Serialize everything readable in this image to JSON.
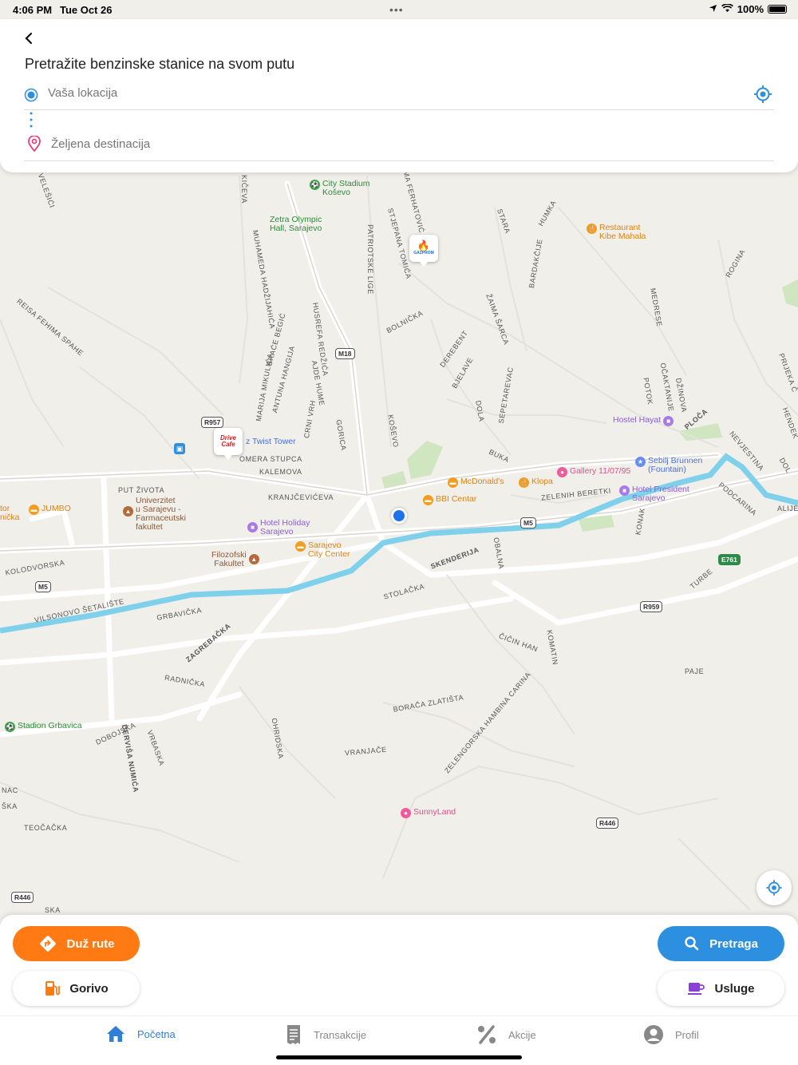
{
  "status_bar": {
    "time": "4:06 PM",
    "date": "Tue Oct 26",
    "dots": "•••",
    "battery": "100%"
  },
  "search": {
    "title": "Pretražite benzinske stanice na svom putu",
    "origin_placeholder": "Vaša lokacija",
    "destination_placeholder": "Željena destinacija"
  },
  "map": {
    "streets": [
      "J VELEŠIĆI",
      "KIČEVA",
      "ASIMA FERHATOVIĆ",
      "STARA",
      "HUMKA",
      "REISA FEHIMA SPAHE",
      "MUHAMEDA HADŽIJAHIĆA",
      "PATRIOTSKE LIGE",
      "STJEPANA TOMIĆA",
      "BARDAKČIJE",
      "ROGINA",
      "BOLNIČKA",
      "HUSREFA REDŽIĆA",
      "BRAĆE BEGIĆ",
      "ŽAIMA ŠARCA",
      "MEDRESE",
      "DEREBENT",
      "MARIJA MIKULIĆA",
      "ANTUNA HANGIJA",
      "AJDE HUME",
      "BJELAVE",
      "OČAKTANIJE",
      "PRIJEKA Č",
      "POTOK",
      "DŽINOVA",
      "CRNI VRH",
      "KOŠEVO",
      "DOLA",
      "SEPETAREVAC",
      "PLOČA",
      "HENDEK",
      "NEVJESTINA",
      "GORICA",
      "OMERA STUPCA",
      "BUKA",
      "KALEMOVA",
      "PUT ŽIVOTA",
      "KRANJČEVIĆEVA",
      "ZELENIH BERETKI",
      "PODCARINA",
      "ALIJE",
      "KONAK",
      "KOLODVORSKA",
      "SKENDERIJA",
      "OBALNA",
      "TURBE",
      "VILSONOVO ŠETALIŠTE",
      "STOLAČKA",
      "GRBAVIČKA",
      "ZAGREBAČKA",
      "ČIČIN HAN",
      "KOMATIN",
      "PAJE",
      "RADNIČKA",
      "BORAČA ZLATIŠTA",
      "DOBOJSKA",
      "DERVIŠA NUMIĆA",
      "OHRIDSKA",
      "VRBASKA",
      "VRANJAČE",
      "ZELENGORSKA HAMBINA CARINA",
      "TEOČAČKA",
      "NAC",
      "SKA",
      "ŠKA",
      "DOL"
    ],
    "pois": {
      "city_stadium": "City Stadium\nKoševo",
      "zetra": "Zetra Olympic\nHall, Sarajevo",
      "restaurant_kibe": "Restaurant\nKibe Mahala",
      "hostel_hayat": "Hostel Hayat",
      "twist_tower": "z Twist Tower",
      "sebilj": "Sebilj Brunnen\n(Fountain)",
      "gallery": "Gallery 11/07/95",
      "mcdonalds": "McDonald's",
      "klopa": "Klopa",
      "hotel_president": "Hotel President\nSarajevo",
      "jumbo": "JUMBO",
      "tor_nicka": "tor\nnička",
      "univerzitet": "Univerzitet\nu Sarajevu -\nFarmaceutski\nfakultet",
      "bbi": "BBI Centar",
      "hotel_holiday": "Hotel Holiday\nSarajevo",
      "filozofski": "Filozofski\nFakultet",
      "city_center": "Sarajevo\nCity Center",
      "stadion_grbavica": "Stadion Grbavica",
      "sunnyland": "SunnyLand"
    },
    "shields": {
      "m18": "M18",
      "r957": "R957",
      "m5a": "M5",
      "m5b": "M5",
      "e761": "E761",
      "r959": "R959",
      "r446a": "R446",
      "r446b": "R446"
    },
    "marker_gazprom": "GAZPROM",
    "marker_drive": "Drive Cafe"
  },
  "actions": {
    "route": "Duž rute",
    "search": "Pretraga",
    "fuel": "Gorivo",
    "services": "Usluge"
  },
  "tabs": {
    "home": "Početna",
    "transactions": "Transakcije",
    "promotions": "Akcije",
    "profile": "Profil"
  }
}
